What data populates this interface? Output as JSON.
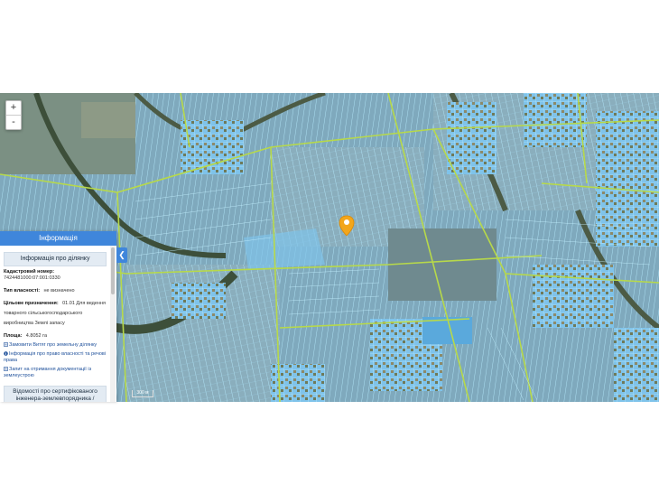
{
  "zoom": {
    "in_label": "+",
    "out_label": "-"
  },
  "panel": {
    "header": "Інформація",
    "subheader": "Інформація про ділянку",
    "cadastral_label": "Кадастровий номер:",
    "cadastral_value": "7424481000:07:001:0330",
    "ownership_label": "Тип власності:",
    "ownership_value": "не визначено",
    "purpose_label": "Цільове призначення:",
    "purpose_value": "01.01 Для ведення товарного сільськогосподарського виробництва Землі запасу",
    "area_label": "Площа:",
    "area_value": "4.8052 га",
    "links": [
      "Замовити Витяг про земельну ділянку",
      "Інформація про право власності та речові права",
      "Запит на отримання документації із землеустрою"
    ],
    "footer": "Відомості про сертифікованого інженера-землевпорядника / БЕЗРОСЕВИЙ ВИКОНАВЕЦЬ"
  },
  "collapse_icon": "chevron-left-icon",
  "marker_icon": "location-pin-icon",
  "scale_label": "300 м",
  "colors": {
    "accent": "#3f86db",
    "marker": "#f2a61b",
    "parcel_fill": "#7fc3ea",
    "parcel_line": "#a7e8ff",
    "boundary": "#b7d94a"
  }
}
